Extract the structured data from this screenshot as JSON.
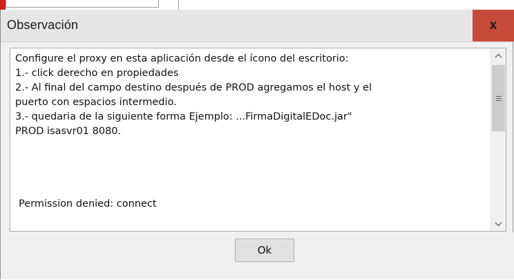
{
  "dialog": {
    "title": "Observación",
    "close_label": "x",
    "message_lines": [
      "Configure el proxy en esta aplicación desde el ícono del escritorio:",
      "1.- click derecho en propiedades",
      "2.- Al final del campo destino después de PROD agregamos el host y el",
      "puerto con espacios intermedio.",
      "3.- quedaria de la siguiente forma Ejemplo: ...FirmaDigitalEDoc.jar\"",
      "PROD isasvr01 8080."
    ],
    "error_text": "Permission denied: connect",
    "ok_label": "Ok"
  },
  "icons": {
    "scroll_up": "chevron-up-icon",
    "scroll_down": "chevron-down-icon",
    "scroll_thumb_grip": "grip-icon"
  },
  "colors": {
    "close_button": "#c74b3b",
    "titlebar": "#e6e6e6",
    "dialog_background": "#f0f0f0"
  }
}
